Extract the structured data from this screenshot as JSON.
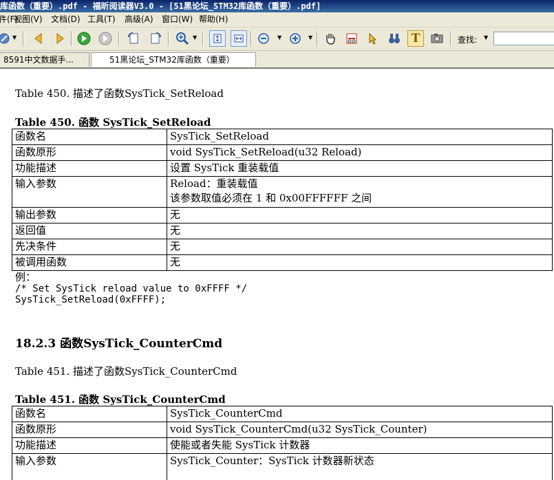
{
  "window": {
    "title": "库函数（重要）.pdf - 福昕阅读器V3.0 - [51黑论坛_STM32库函数（重要）.pdf]"
  },
  "menu": [
    {
      "label": "文件(F)"
    },
    {
      "label": "视图(V)"
    },
    {
      "label": "文档(D)"
    },
    {
      "label": "工具(T)"
    },
    {
      "label": "高级(A)"
    },
    {
      "label": "窗口(W)"
    },
    {
      "label": "帮助(H)"
    }
  ],
  "toolbar": {
    "find_label": "查找:",
    "find_value": ""
  },
  "tabs": [
    {
      "label": "8591中文数据手..."
    },
    {
      "label": "51黑论坛_STM32库函数（重要）"
    }
  ],
  "doc": {
    "intro1": "Table 450.  描述了函数SysTick_SetReload",
    "caption1": "Table 450.  函数 SysTick_SetReload",
    "table1": [
      {
        "k": "函数名",
        "v": "SysTick_SetReload"
      },
      {
        "k": "函数原形",
        "v": "void SysTick_SetReload(u32 Reload)"
      },
      {
        "k": "功能描述",
        "v": "设置 SysTick 重装载值"
      },
      {
        "k": "输入参数",
        "v": "Reload：重装载值",
        "v2": "该参数取值必须在 1 和 0x00FFFFFF 之间"
      },
      {
        "k": "输出参数",
        "v": "无"
      },
      {
        "k": "返回值",
        "v": "无"
      },
      {
        "k": "先决条件",
        "v": "无"
      },
      {
        "k": "被调用函数",
        "v": "无"
      }
    ],
    "example_label": "例：",
    "code_line1": "/* Set SysTick reload value to 0xFFFF */",
    "code_line2": "SysTick_SetReload(0xFFFF);",
    "section_heading": "18.2.3  函数SysTick_CounterCmd",
    "intro2": "Table 451.  描述了函数SysTick_CounterCmd",
    "caption2": "Table 451.  函数 SysTick_CounterCmd",
    "table2": [
      {
        "k": "函数名",
        "v": "SysTick_CounterCmd"
      },
      {
        "k": "函数原形",
        "v": "void SysTick_CounterCmd(u32 SysTick_Counter)"
      },
      {
        "k": "功能描述",
        "v": "使能或者失能 SysTick 计数器"
      },
      {
        "k": "输入参数",
        "v": "SysTick_Counter：SysTick 计数器新状态"
      }
    ]
  },
  "colors": {
    "titlebar": "#0a246a",
    "chrome": "#ece9d8"
  }
}
